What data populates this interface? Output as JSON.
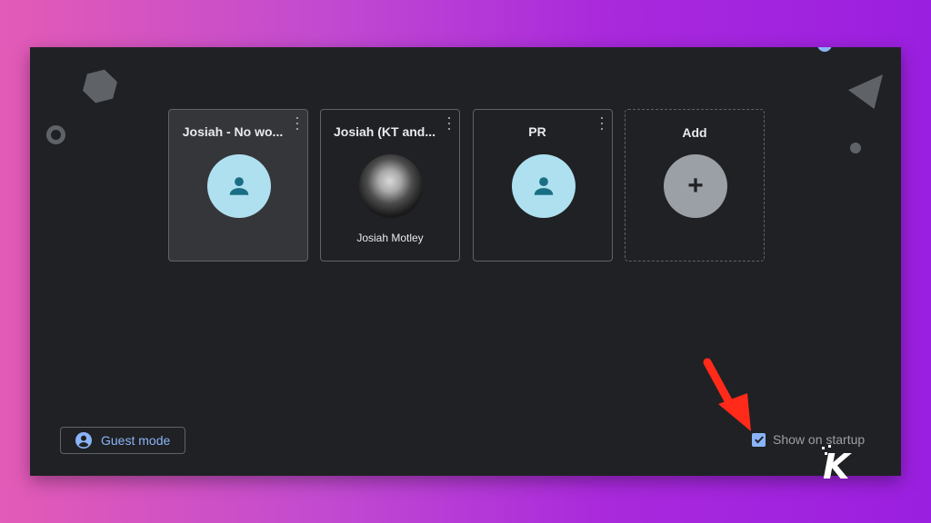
{
  "profiles": [
    {
      "name": "Josiah - No wo...",
      "subtitle": "",
      "avatar": "default-person-icon",
      "selected": true
    },
    {
      "name": "Josiah (KT and...",
      "subtitle": "Josiah Motley",
      "avatar": "user-photo",
      "selected": false
    },
    {
      "name": "PR",
      "subtitle": "",
      "avatar": "default-person-icon",
      "selected": false
    }
  ],
  "add_tile": {
    "label": "Add",
    "icon": "plus-icon"
  },
  "guest_mode": {
    "label": "Guest mode",
    "icon": "guest-person-icon"
  },
  "show_on_startup": {
    "label": "Show on startup",
    "checked": true
  },
  "colors": {
    "accent": "#8ab4f8",
    "avatar_bg": "#aee0f0",
    "avatar_glyph": "#1a6e84",
    "window_bg": "#202124",
    "annotation_arrow": "#ff2a1a"
  },
  "watermark": {
    "letter": "K"
  }
}
